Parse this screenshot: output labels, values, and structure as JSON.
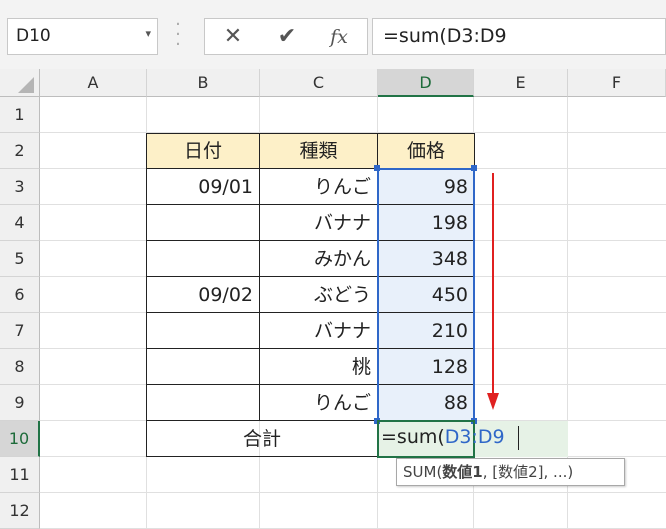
{
  "formula_bar": {
    "name_box": "D10",
    "cancel_icon": "✕",
    "enter_icon": "✔",
    "fx_label": "fx",
    "formula": "=sum(D3:D9"
  },
  "columns": [
    "A",
    "B",
    "C",
    "D",
    "E",
    "F"
  ],
  "rows": [
    "1",
    "2",
    "3",
    "4",
    "5",
    "6",
    "7",
    "8",
    "9",
    "10",
    "11",
    "12"
  ],
  "table": {
    "headers": [
      "日付",
      "種類",
      "価格"
    ],
    "rows": [
      {
        "date": "09/01",
        "type": "りんご",
        "price": "98"
      },
      {
        "date": "",
        "type": "バナナ",
        "price": "198"
      },
      {
        "date": "",
        "type": "みかん",
        "price": "348"
      },
      {
        "date": "09/02",
        "type": "ぶどう",
        "price": "450"
      },
      {
        "date": "",
        "type": "バナナ",
        "price": "210"
      },
      {
        "date": "",
        "type": "桃",
        "price": "128"
      },
      {
        "date": "",
        "type": "りんご",
        "price": "88"
      }
    ],
    "total_label": "合計",
    "edit_prefix": "=sum(",
    "edit_ref": "D3:D9"
  },
  "tooltip": {
    "fn": "SUM(",
    "arg1": "数値1",
    "rest": ", [数値2], ...)"
  },
  "colors": {
    "header_fill": "#fdf0c8",
    "range_fill": "#e8f0fa",
    "range_border": "#2f67c8",
    "arrow": "#e02020",
    "ref_text": "#2f67c8"
  }
}
